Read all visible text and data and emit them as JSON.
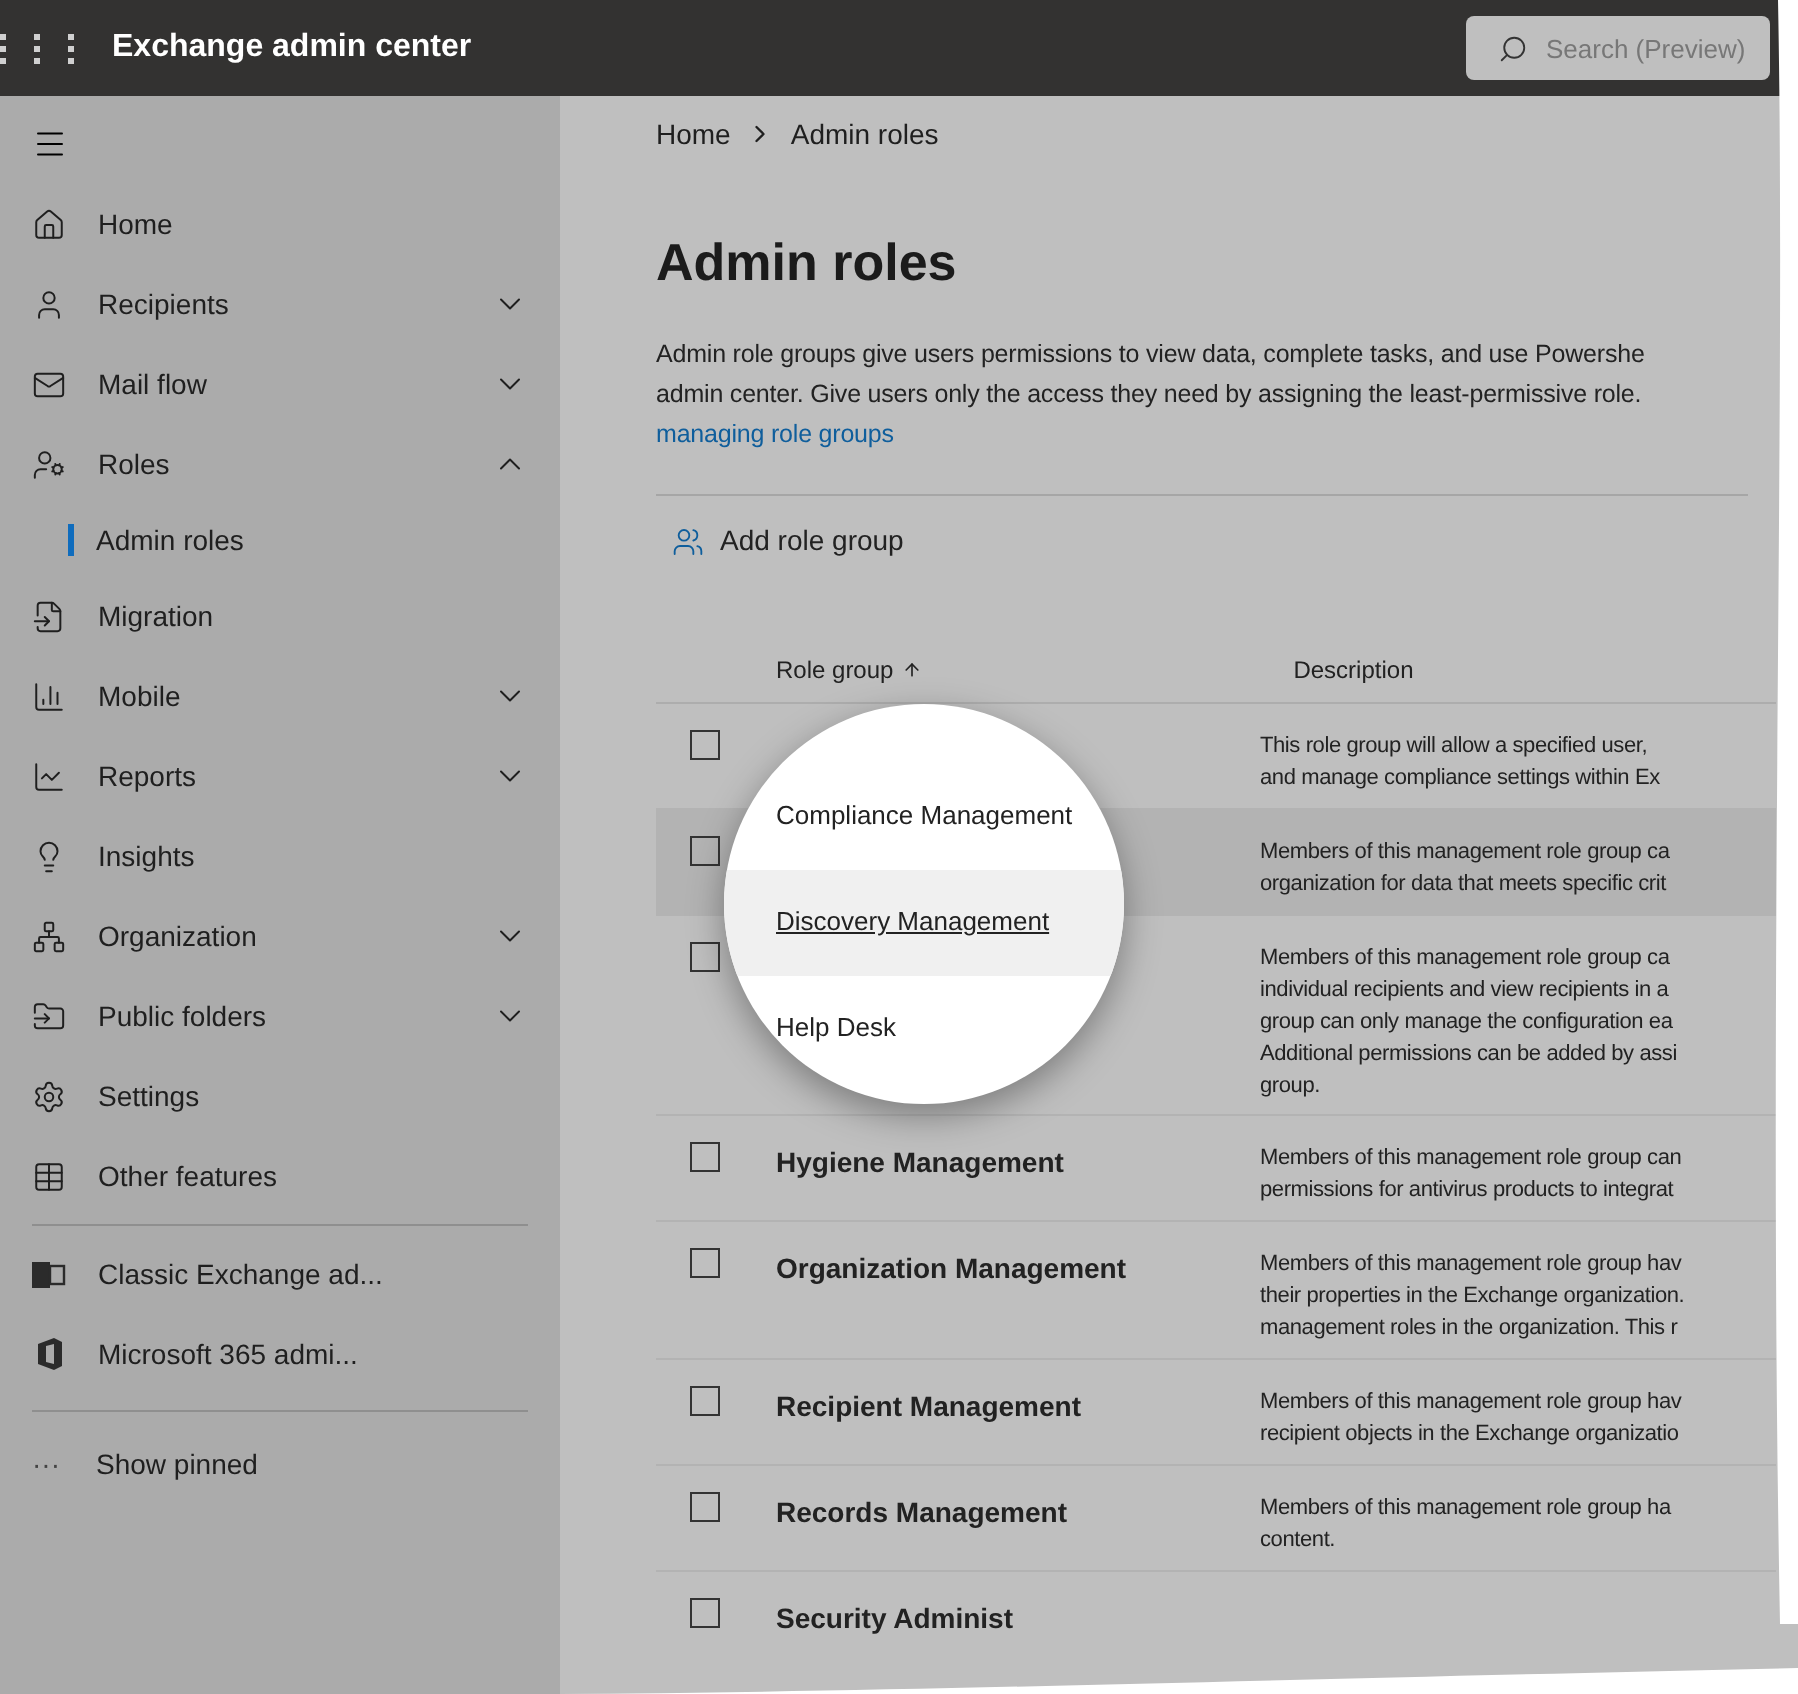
{
  "app_title": "Exchange admin center",
  "search": {
    "placeholder": "Search (Preview)"
  },
  "sidebar": {
    "items": [
      {
        "label": "Home"
      },
      {
        "label": "Recipients",
        "expanded": false
      },
      {
        "label": "Mail flow",
        "expanded": false
      },
      {
        "label": "Roles",
        "expanded": true,
        "children": [
          {
            "label": "Admin roles",
            "selected": true
          }
        ]
      },
      {
        "label": "Migration"
      },
      {
        "label": "Mobile",
        "expanded": false
      },
      {
        "label": "Reports",
        "expanded": false
      },
      {
        "label": "Insights"
      },
      {
        "label": "Organization",
        "expanded": false
      },
      {
        "label": "Public folders",
        "expanded": false
      },
      {
        "label": "Settings"
      },
      {
        "label": "Other features"
      }
    ],
    "links": [
      {
        "label": "Classic Exchange ad..."
      },
      {
        "label": "Microsoft 365 admi..."
      }
    ],
    "show_pinned": {
      "icon": "···",
      "label": "Show pinned"
    }
  },
  "breadcrumb": [
    "Home",
    "Admin roles"
  ],
  "title": "Admin roles",
  "intro": "Admin role groups give users permissions to view data, complete tasks, and use Powershe\nadmin center. Give users only the access they need by assigning the least-permissive role.",
  "intro_link": "managing role groups",
  "toolbar": {
    "add_label": "Add role group"
  },
  "table": {
    "columns": [
      {
        "label": "Role group"
      },
      {
        "label": "Description"
      }
    ],
    "rows": [
      {
        "name": "Compliance Management",
        "description": "This role group will allow a specified user,\nand manage compliance settings within Ex",
        "checked": false,
        "hovered": false,
        "magnified": true
      },
      {
        "name": "Discovery Management",
        "description": "Members of this management role group ca\norganization for data that meets specific crit",
        "checked": false,
        "hovered": true,
        "magnified": true
      },
      {
        "name": "Help Desk",
        "description": "Members of this management role group ca\nindividual recipients and view recipients in a\ngroup can only manage the configuration ea\nAdditional permissions can be added by assi\ngroup.",
        "checked": false,
        "hovered": false,
        "magnified": true
      },
      {
        "name": "Hygiene Management",
        "description": "Members of this management role group can\npermissions for antivirus products to integrat",
        "checked": false,
        "hovered": false,
        "magnified": false
      },
      {
        "name": "Organization Management",
        "description": "Members of this management role group hav\ntheir properties in the Exchange organization.\nmanagement roles in the organization. This r",
        "checked": false,
        "hovered": false,
        "magnified": false
      },
      {
        "name": "Recipient Management",
        "description": "Members of this management role group hav\nrecipient objects in the Exchange organizatio",
        "checked": false,
        "hovered": false,
        "magnified": false
      },
      {
        "name": "Records Management",
        "description": "Members of this management role group ha\ncontent.",
        "checked": false,
        "hovered": false,
        "magnified": false
      },
      {
        "name": "Security Administ",
        "checked": false,
        "hovered": false,
        "magnified": false
      }
    ]
  }
}
